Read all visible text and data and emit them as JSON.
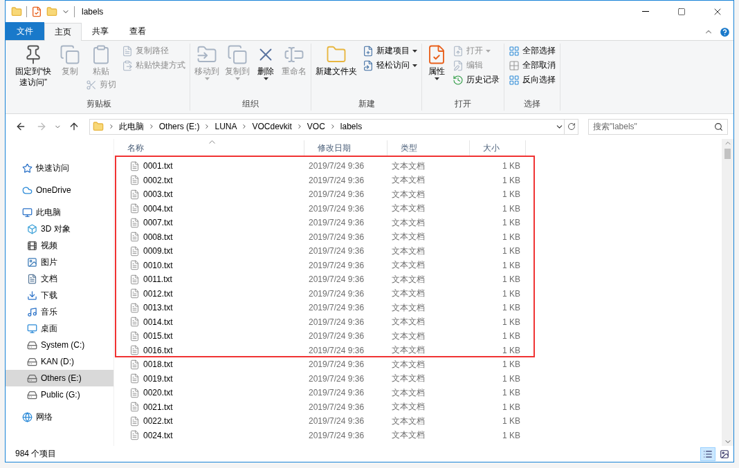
{
  "window": {
    "title": "labels"
  },
  "tabs": [
    {
      "label": "文件",
      "kind": "file",
      "selected": false
    },
    {
      "label": "主页",
      "kind": "tab",
      "selected": true
    },
    {
      "label": "共享",
      "kind": "tab",
      "selected": false
    },
    {
      "label": "查看",
      "kind": "tab",
      "selected": false
    }
  ],
  "ribbon": {
    "groups": [
      {
        "label": "剪贴板",
        "columns": [
          [
            {
              "label": "固定到“快速访问”",
              "kind": "large",
              "disabled": false,
              "dropdown": false
            }
          ],
          [
            {
              "label": "复制",
              "kind": "large",
              "disabled": true,
              "dropdown": false
            }
          ],
          [
            {
              "label": "粘贴",
              "kind": "large",
              "disabled": true,
              "dropdown": false
            },
            {
              "label": "剪切",
              "kind": "small",
              "disabled": true,
              "dropdown": false
            }
          ],
          [
            {
              "label": "复制路径",
              "kind": "small",
              "disabled": true,
              "dropdown": false
            },
            {
              "label": "粘贴快捷方式",
              "kind": "small",
              "disabled": true,
              "dropdown": false
            }
          ]
        ]
      },
      {
        "label": "组织",
        "columns": [
          [
            {
              "label": "移动到",
              "kind": "large",
              "disabled": true,
              "dropdown": true
            }
          ],
          [
            {
              "label": "复制到",
              "kind": "large",
              "disabled": true,
              "dropdown": true
            }
          ],
          [
            {
              "label": "删除",
              "kind": "large",
              "disabled": false,
              "dropdown": true
            }
          ],
          [
            {
              "label": "重命名",
              "kind": "large",
              "disabled": true,
              "dropdown": false
            }
          ]
        ]
      },
      {
        "label": "新建",
        "columns": [
          [
            {
              "label": "新建文件夹",
              "kind": "large",
              "disabled": false,
              "dropdown": false
            }
          ],
          [
            {
              "label": "新建项目",
              "kind": "small",
              "disabled": false,
              "dropdown": true
            },
            {
              "label": "轻松访问",
              "kind": "small",
              "disabled": false,
              "dropdown": true
            }
          ]
        ]
      },
      {
        "label": "打开",
        "columns": [
          [
            {
              "label": "属性",
              "kind": "large",
              "disabled": false,
              "dropdown": true
            }
          ],
          [
            {
              "label": "打开",
              "kind": "small",
              "disabled": true,
              "dropdown": true
            },
            {
              "label": "编辑",
              "kind": "small",
              "disabled": true,
              "dropdown": false
            },
            {
              "label": "历史记录",
              "kind": "small",
              "disabled": false,
              "dropdown": false
            }
          ]
        ]
      },
      {
        "label": "选择",
        "columns": [
          [
            {
              "label": "全部选择",
              "kind": "small",
              "disabled": false,
              "dropdown": false
            },
            {
              "label": "全部取消",
              "kind": "small",
              "disabled": false,
              "dropdown": false
            },
            {
              "label": "反向选择",
              "kind": "small",
              "disabled": false,
              "dropdown": false
            }
          ]
        ]
      }
    ]
  },
  "address": {
    "crumbs": [
      "此电脑",
      "Others (E:)",
      "LUNA",
      "VOCdevkit",
      "VOC",
      "labels"
    ],
    "search": {
      "placeholder": "搜索\"labels\""
    }
  },
  "sidebar": {
    "items": [
      {
        "label": "快速访问",
        "selected": false
      },
      {
        "label": "OneDrive",
        "selected": false
      },
      {
        "label": "此电脑",
        "selected": false,
        "children": [
          {
            "label": "3D 对象",
            "selected": false
          },
          {
            "label": "视频",
            "selected": false
          },
          {
            "label": "图片",
            "selected": false
          },
          {
            "label": "文档",
            "selected": false
          },
          {
            "label": "下载",
            "selected": false
          },
          {
            "label": "音乐",
            "selected": false
          },
          {
            "label": "桌面",
            "selected": false
          },
          {
            "label": "System (C:)",
            "selected": false
          },
          {
            "label": "KAN (D:)",
            "selected": false
          },
          {
            "label": "Others (E:)",
            "selected": true
          },
          {
            "label": "Public (G:)",
            "selected": false
          }
        ]
      },
      {
        "label": "网络",
        "selected": false
      }
    ]
  },
  "table": {
    "columns": [
      {
        "label": "名称",
        "sorted": true
      },
      {
        "label": "修改日期",
        "sorted": false
      },
      {
        "label": "类型",
        "sorted": false
      },
      {
        "label": "大小",
        "sorted": false
      }
    ],
    "rows": [
      {
        "name": "0001.txt",
        "modified": "2019/7/24 9:36",
        "type": "文本文档",
        "size": "1 KB"
      },
      {
        "name": "0002.txt",
        "modified": "2019/7/24 9:36",
        "type": "文本文档",
        "size": "1 KB"
      },
      {
        "name": "0003.txt",
        "modified": "2019/7/24 9:36",
        "type": "文本文档",
        "size": "1 KB"
      },
      {
        "name": "0004.txt",
        "modified": "2019/7/24 9:36",
        "type": "文本文档",
        "size": "1 KB"
      },
      {
        "name": "0007.txt",
        "modified": "2019/7/24 9:36",
        "type": "文本文档",
        "size": "1 KB"
      },
      {
        "name": "0008.txt",
        "modified": "2019/7/24 9:36",
        "type": "文本文档",
        "size": "1 KB"
      },
      {
        "name": "0009.txt",
        "modified": "2019/7/24 9:36",
        "type": "文本文档",
        "size": "1 KB"
      },
      {
        "name": "0010.txt",
        "modified": "2019/7/24 9:36",
        "type": "文本文档",
        "size": "1 KB"
      },
      {
        "name": "0011.txt",
        "modified": "2019/7/24 9:36",
        "type": "文本文档",
        "size": "1 KB"
      },
      {
        "name": "0012.txt",
        "modified": "2019/7/24 9:36",
        "type": "文本文档",
        "size": "1 KB"
      },
      {
        "name": "0013.txt",
        "modified": "2019/7/24 9:36",
        "type": "文本文档",
        "size": "1 KB"
      },
      {
        "name": "0014.txt",
        "modified": "2019/7/24 9:36",
        "type": "文本文档",
        "size": "1 KB"
      },
      {
        "name": "0015.txt",
        "modified": "2019/7/24 9:36",
        "type": "文本文档",
        "size": "1 KB"
      },
      {
        "name": "0016.txt",
        "modified": "2019/7/24 9:36",
        "type": "文本文档",
        "size": "1 KB"
      },
      {
        "name": "0018.txt",
        "modified": "2019/7/24 9:36",
        "type": "文本文档",
        "size": "1 KB"
      },
      {
        "name": "0019.txt",
        "modified": "2019/7/24 9:36",
        "type": "文本文档",
        "size": "1 KB"
      },
      {
        "name": "0020.txt",
        "modified": "2019/7/24 9:36",
        "type": "文本文档",
        "size": "1 KB"
      },
      {
        "name": "0021.txt",
        "modified": "2019/7/24 9:36",
        "type": "文本文档",
        "size": "1 KB"
      },
      {
        "name": "0022.txt",
        "modified": "2019/7/24 9:36",
        "type": "文本文档",
        "size": "1 KB"
      },
      {
        "name": "0024.txt",
        "modified": "2019/7/24 9:36",
        "type": "文本文档",
        "size": "1 KB"
      }
    ]
  },
  "status_bar": {
    "item_count": "984 个项目",
    "views": [
      {
        "kind": "details",
        "selected": true
      },
      {
        "kind": "large_icons",
        "selected": false
      }
    ]
  }
}
